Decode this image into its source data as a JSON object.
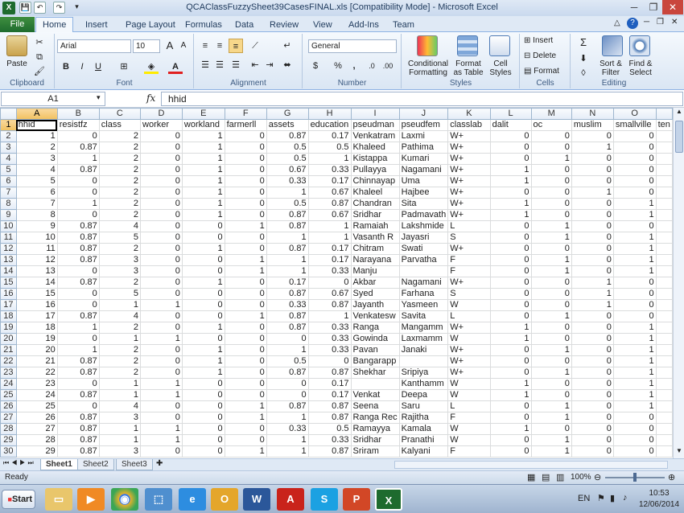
{
  "window": {
    "title": "QCAClassFuzzySheet39CasesFINAL.xls  [Compatibility Mode] - Microsoft Excel"
  },
  "tabs": [
    "File",
    "Home",
    "Insert",
    "Page Layout",
    "Formulas",
    "Data",
    "Review",
    "View",
    "Add-Ins",
    "Team"
  ],
  "ribbon": {
    "clipboard": {
      "paste": "Paste",
      "label": "Clipboard"
    },
    "font": {
      "name": "Arial",
      "size": "10",
      "bold": "B",
      "italic": "I",
      "underline": "U",
      "grow": "A",
      "shrink": "A",
      "label": "Font"
    },
    "alignment": {
      "label": "Alignment"
    },
    "number": {
      "format": "General",
      "currency": "$",
      "percent": "%",
      "comma": ",",
      "label": "Number"
    },
    "styles": {
      "conditional": "Conditional Formatting",
      "table": "Format as Table",
      "cell": "Cell Styles",
      "label": "Styles"
    },
    "cells": {
      "insert": "Insert",
      "delete": "Delete",
      "format": "Format",
      "label": "Cells"
    },
    "editing": {
      "sum": "Σ",
      "sort": "Sort & Filter",
      "find": "Find & Select",
      "label": "Editing"
    }
  },
  "formula_bar": {
    "name_box": "A1",
    "fx": "fx",
    "value": "hhid"
  },
  "columns": [
    "A",
    "B",
    "C",
    "D",
    "E",
    "F",
    "G",
    "H",
    "I",
    "J",
    "K",
    "L",
    "M",
    "N",
    "O",
    ""
  ],
  "headers": [
    "hhid",
    "resistfz",
    "class",
    "worker",
    "workland",
    "farmerll",
    "assets",
    "education",
    "pseudman",
    "pseudfem",
    "classlab",
    "dalit",
    "oc",
    "muslim",
    "smallville",
    "ten"
  ],
  "rows": [
    [
      "1",
      "0",
      "2",
      "0",
      "1",
      "0",
      "0.87",
      "0.17",
      "Venkatram",
      "Laxmi",
      "W+",
      "0",
      "0",
      "0",
      "0"
    ],
    [
      "2",
      "0.87",
      "2",
      "0",
      "1",
      "0",
      "0.5",
      "0.5",
      "Khaleed",
      "Pathima",
      "W+",
      "0",
      "0",
      "1",
      "0"
    ],
    [
      "3",
      "1",
      "2",
      "0",
      "1",
      "0",
      "0.5",
      "1",
      "Kistappa",
      "Kumari",
      "W+",
      "0",
      "1",
      "0",
      "0"
    ],
    [
      "4",
      "0.87",
      "2",
      "0",
      "1",
      "0",
      "0.67",
      "0.33",
      "Pullayya",
      "Nagamani",
      "W+",
      "1",
      "0",
      "0",
      "0"
    ],
    [
      "5",
      "0",
      "2",
      "0",
      "1",
      "0",
      "0.33",
      "0.17",
      "Chinnayap",
      "Uma",
      "W+",
      "1",
      "0",
      "0",
      "0"
    ],
    [
      "6",
      "0",
      "2",
      "0",
      "1",
      "0",
      "1",
      "0.67",
      "Khaleel",
      "Hajbee",
      "W+",
      "0",
      "0",
      "1",
      "0"
    ],
    [
      "7",
      "1",
      "2",
      "0",
      "1",
      "0",
      "0.5",
      "0.87",
      "Chandran",
      "Sita",
      "W+",
      "1",
      "0",
      "0",
      "1"
    ],
    [
      "8",
      "0",
      "2",
      "0",
      "1",
      "0",
      "0.87",
      "0.67",
      "Sridhar",
      "Padmavath",
      "W+",
      "1",
      "0",
      "0",
      "1"
    ],
    [
      "9",
      "0.87",
      "4",
      "0",
      "0",
      "1",
      "0.87",
      "1",
      "Ramaiah",
      "Lakshmide",
      "L",
      "0",
      "1",
      "0",
      "0"
    ],
    [
      "10",
      "0.87",
      "5",
      "0",
      "0",
      "0",
      "1",
      "1",
      "Vasanth R",
      "Jayasri",
      "S",
      "0",
      "1",
      "0",
      "1"
    ],
    [
      "11",
      "0.87",
      "2",
      "0",
      "1",
      "0",
      "0.87",
      "0.17",
      "Chitram",
      "Swati",
      "W+",
      "0",
      "0",
      "0",
      "1"
    ],
    [
      "12",
      "0.87",
      "3",
      "0",
      "0",
      "1",
      "1",
      "0.17",
      "Narayana",
      "Parvatha",
      "F",
      "0",
      "1",
      "0",
      "1"
    ],
    [
      "13",
      "0",
      "3",
      "0",
      "0",
      "1",
      "1",
      "0.33",
      "Manju",
      "",
      "F",
      "0",
      "1",
      "0",
      "1"
    ],
    [
      "14",
      "0.87",
      "2",
      "0",
      "1",
      "0",
      "0.17",
      "0",
      "Akbar",
      "Nagamani",
      "W+",
      "0",
      "0",
      "1",
      "0"
    ],
    [
      "15",
      "0",
      "5",
      "0",
      "0",
      "0",
      "0.87",
      "0.67",
      "Syed",
      "Farhana",
      "S",
      "0",
      "0",
      "1",
      "0"
    ],
    [
      "16",
      "0",
      "1",
      "1",
      "0",
      "0",
      "0.33",
      "0.87",
      "Jayanth",
      "Yasmeen",
      "W",
      "0",
      "0",
      "1",
      "0"
    ],
    [
      "17",
      "0.87",
      "4",
      "0",
      "0",
      "1",
      "0.87",
      "1",
      "Venkatesw",
      "Savita",
      "L",
      "0",
      "1",
      "0",
      "0"
    ],
    [
      "18",
      "1",
      "2",
      "0",
      "1",
      "0",
      "0.87",
      "0.33",
      "Ranga",
      "Mangamm",
      "W+",
      "1",
      "0",
      "0",
      "1"
    ],
    [
      "19",
      "0",
      "1",
      "1",
      "0",
      "0",
      "0",
      "0.33",
      "Gowinda",
      "Laxmamm",
      "W",
      "1",
      "0",
      "0",
      "1"
    ],
    [
      "20",
      "1",
      "2",
      "0",
      "1",
      "0",
      "1",
      "0.33",
      "Pavan",
      "Janaki",
      "W+",
      "0",
      "1",
      "0",
      "1"
    ],
    [
      "21",
      "0.87",
      "2",
      "0",
      "1",
      "0",
      "0.5",
      "0",
      "Bangarapp",
      "",
      "W+",
      "0",
      "0",
      "0",
      "1"
    ],
    [
      "22",
      "0.87",
      "2",
      "0",
      "1",
      "0",
      "0.87",
      "0.87",
      "Shekhar",
      "Sripiya",
      "W+",
      "0",
      "1",
      "0",
      "1"
    ],
    [
      "23",
      "0",
      "1",
      "1",
      "0",
      "0",
      "0",
      "0.17",
      "",
      "Kanthamm",
      "W",
      "1",
      "0",
      "0",
      "1"
    ],
    [
      "24",
      "0.87",
      "1",
      "1",
      "0",
      "0",
      "0",
      "0.17",
      "Venkat",
      "Deepa",
      "W",
      "1",
      "0",
      "0",
      "1"
    ],
    [
      "25",
      "0",
      "4",
      "0",
      "0",
      "1",
      "0.87",
      "0.87",
      "Seena",
      "Saru",
      "L",
      "0",
      "1",
      "0",
      "1"
    ],
    [
      "26",
      "0.87",
      "3",
      "0",
      "0",
      "1",
      "1",
      "0.87",
      "Ranga Rec",
      "Rajitha",
      "F",
      "0",
      "1",
      "0",
      "0"
    ],
    [
      "27",
      "0.87",
      "1",
      "1",
      "0",
      "0",
      "0.33",
      "0.5",
      "Ramayya",
      "Kamala",
      "W",
      "1",
      "0",
      "0",
      "0"
    ],
    [
      "28",
      "0.87",
      "1",
      "1",
      "0",
      "0",
      "1",
      "0.33",
      "Sridhar",
      "Pranathi",
      "W",
      "0",
      "1",
      "0",
      "0"
    ],
    [
      "29",
      "0.87",
      "3",
      "0",
      "0",
      "1",
      "1",
      "0.87",
      "Sriram",
      "Kalyani",
      "F",
      "0",
      "1",
      "0",
      "0"
    ]
  ],
  "sheets": [
    "Sheet1",
    "Sheet2",
    "Sheet3"
  ],
  "status": {
    "ready": "Ready",
    "zoom": "100%"
  },
  "taskbar": {
    "start": "Start",
    "lang": "EN",
    "time": "10:53",
    "date": "12/06/2014"
  },
  "colors": {
    "accent": "#217346",
    "header_bg": "#e4ecf7",
    "selected_header": "#f1c15f"
  }
}
